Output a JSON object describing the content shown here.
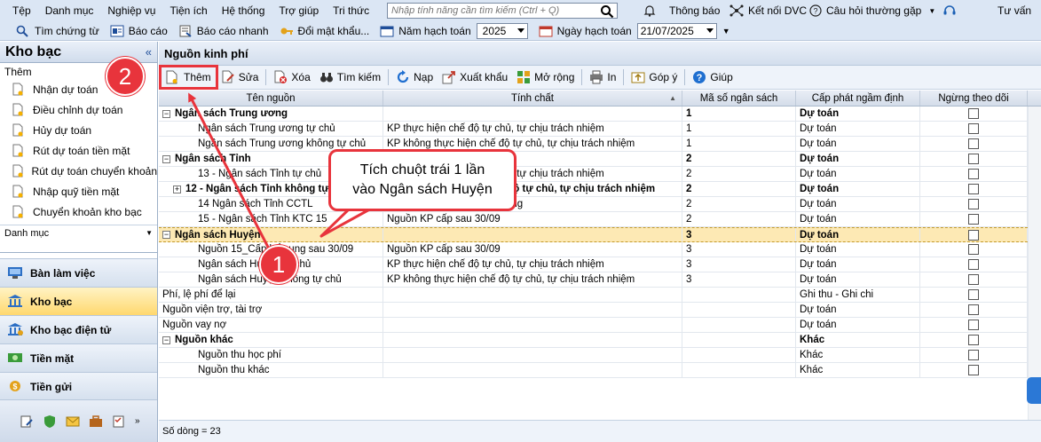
{
  "menubar": {
    "items": [
      "Tệp",
      "Danh mục",
      "Nghiệp vụ",
      "Tiện ích",
      "Hệ thống",
      "Trợ giúp",
      "Tri thức"
    ],
    "search_placeholder": "Nhập tính năng cần tìm kiếm (Ctrl + Q)",
    "notifications": "Thông báo",
    "connect_dvc": "Kết nối DVC",
    "faq": "Câu hỏi thường gặp",
    "advisory": "Tư vấn"
  },
  "toolbar2": {
    "find_voucher": "Tìm chứng từ",
    "report": "Báo cáo",
    "quick_report": "Báo cáo nhanh",
    "change_password": "Đổi mật khẩu...",
    "fiscal_year_label": "Năm hạch toán",
    "fiscal_year_value": "2025",
    "posting_date_label": "Ngày hạch toán",
    "posting_date_value": "21/07/2025"
  },
  "sidebar": {
    "title": "Kho bạc",
    "section_add": "Thêm",
    "items": [
      "Nhận dự toán",
      "Điều chỉnh dự toán",
      "Hủy dự toán",
      "Rút dự toán tiền mặt",
      "Rút dự toán chuyển khoản",
      "Nhập quỹ tiền mặt",
      "Chuyển khoản kho bạc"
    ],
    "section_catalog": "Danh mục",
    "nav": [
      "Bàn làm việc",
      "Kho bạc",
      "Kho bạc điện tử",
      "Tiền mặt",
      "Tiền gửi"
    ]
  },
  "main": {
    "title": "Nguồn kinh phí",
    "toolbar": [
      "Thêm",
      "Sửa",
      "Xóa",
      "Tìm kiếm",
      "Nạp",
      "Xuất khẩu",
      "Mở rộng",
      "In",
      "Góp ý",
      "Giúp"
    ],
    "columns": [
      "Tên nguồn",
      "Tính chất",
      "Mã số ngân sách",
      "Cấp phát ngầm định",
      "Ngừng theo dõi"
    ],
    "rows": [
      {
        "name": "Ngân sách Trung ương",
        "prop": "",
        "code": "1",
        "alloc": "Dự toán",
        "level": 0,
        "bold": true,
        "expander": "−"
      },
      {
        "name": "Ngân sách Trung ương tự chủ",
        "prop": "KP thực hiện chế độ tự chủ, tự chịu trách nhiệm",
        "code": "1",
        "alloc": "Dự toán",
        "level": 2
      },
      {
        "name": "Ngân sách Trung ương không tự chủ",
        "prop": "KP không thực hiện chế độ tự chủ, tự chịu trách nhiệm",
        "code": "1",
        "alloc": "Dự toán",
        "level": 2
      },
      {
        "name": "Ngân sách Tỉnh",
        "prop": "",
        "code": "2",
        "alloc": "Dự toán",
        "level": 0,
        "bold": true,
        "expander": "−"
      },
      {
        "name": "13 - Ngân sách Tỉnh tự chủ",
        "prop": "KP thực hiện chế độ tự chủ, tự chịu trách nhiệm",
        "code": "2",
        "alloc": "Dự toán",
        "level": 2
      },
      {
        "name": "12 - Ngân sách Tỉnh không tự chủ",
        "prop": "KP không thực hiện chế độ tự chủ, tự chịu trách nhiệm",
        "code": "2",
        "alloc": "Dự toán",
        "level": 1,
        "bold": true,
        "expander": "+"
      },
      {
        "name": "14 Ngân sách Tỉnh CCTL",
        "prop": "Nguồn KP cải cách tiền lương",
        "code": "2",
        "alloc": "Dự toán",
        "level": 2
      },
      {
        "name": "15 - Ngân sách Tỉnh KTC 15",
        "prop": "Nguồn KP cấp sau 30/09",
        "code": "2",
        "alloc": "Dự toán",
        "level": 2
      },
      {
        "name": "Ngân sách Huyện",
        "prop": "",
        "code": "3",
        "alloc": "Dự toán",
        "level": 0,
        "bold": true,
        "expander": "−",
        "selected": true
      },
      {
        "name": "Nguồn 15_Cấp bổ sung sau 30/09",
        "prop": "Nguồn KP cấp sau 30/09",
        "code": "3",
        "alloc": "Dự toán",
        "level": 2
      },
      {
        "name": "Ngân sách Huyện tự chủ",
        "prop": "KP thực hiện chế độ tự chủ, tự chịu trách nhiệm",
        "code": "3",
        "alloc": "Dự toán",
        "level": 2
      },
      {
        "name": "Ngân sách Huyện không tự chủ",
        "prop": "KP không thực hiện chế độ tự chủ, tự chịu trách nhiệm",
        "code": "3",
        "alloc": "Dự toán",
        "level": 2
      },
      {
        "name": "Phí, lệ phí để lại",
        "prop": "",
        "code": "",
        "alloc": "Ghi thu - Ghi chi",
        "level": 3
      },
      {
        "name": "Nguồn viện trợ, tài trợ",
        "prop": "",
        "code": "",
        "alloc": "Dự toán",
        "level": 3
      },
      {
        "name": "Nguồn vay nợ",
        "prop": "",
        "code": "",
        "alloc": "Dự toán",
        "level": 3
      },
      {
        "name": "Nguồn khác",
        "prop": "",
        "code": "",
        "alloc": "Khác",
        "level": 0,
        "bold": true,
        "expander": "−"
      },
      {
        "name": "Nguồn thu học phí",
        "prop": "",
        "code": "",
        "alloc": "Khác",
        "level": 2
      },
      {
        "name": "Nguồn thu khác",
        "prop": "",
        "code": "",
        "alloc": "Khác",
        "level": 2
      }
    ],
    "status": "Số dòng = 23"
  },
  "annotations": {
    "badge1": "1",
    "badge2": "2",
    "callout_line1": "Tích chuột trái 1 lần",
    "callout_line2": "vào Ngân sách Huyện",
    "color": "#e8343c"
  }
}
